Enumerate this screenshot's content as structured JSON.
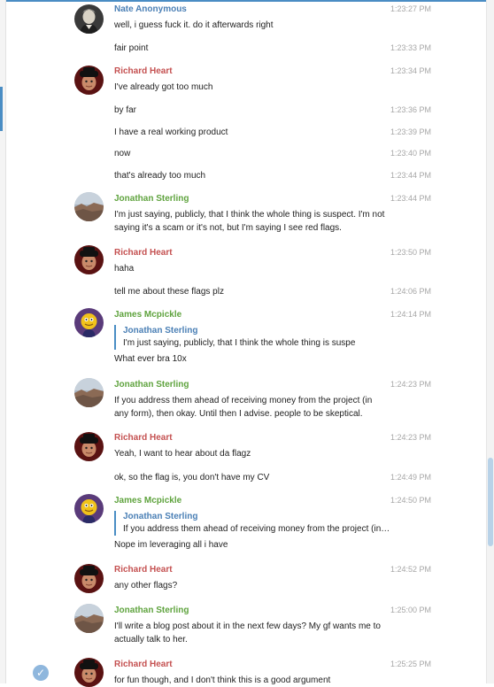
{
  "colors": {
    "accent": "#4a8dc4",
    "sender_red": "#c45050",
    "sender_green": "#5fa33e",
    "sender_blue": "#4a7fb5"
  },
  "icons": {
    "avatar_nate": "portrait-avatar-icon",
    "avatar_richard": "man-with-hat-avatar-icon",
    "avatar_jonathan": "landscape-avatar-icon",
    "avatar_james": "cartoon-avatar-icon",
    "read": "check-icon"
  },
  "messages": [
    {
      "sender": "Nate Anonymous",
      "time": "1:23:27 PM",
      "text": "well, i guess fuck it.  do it afterwards right"
    },
    {
      "time": "1:23:33 PM",
      "text": "fair point"
    },
    {
      "sender": "Richard Heart",
      "time": "1:23:34 PM",
      "text": "I've already got too much"
    },
    {
      "time": "1:23:36 PM",
      "text": "by far"
    },
    {
      "time": "1:23:39 PM",
      "text": "I have a real working product"
    },
    {
      "time": "1:23:40 PM",
      "text": "now"
    },
    {
      "time": "1:23:44 PM",
      "text": "that's already too much"
    },
    {
      "sender": "Jonathan Sterling",
      "time": "1:23:44 PM",
      "text": "I'm just saying, publicly, that I think the whole thing is suspect. I'm not saying it's a scam or it's not, but I'm saying I see red flags."
    },
    {
      "sender": "Richard Heart",
      "time": "1:23:50 PM",
      "text": "haha"
    },
    {
      "time": "1:24:06 PM",
      "text": "tell me about these flags plz"
    },
    {
      "sender": "James Mcpickle",
      "time": "1:24:14 PM",
      "reply_name": "Jonathan Sterling",
      "reply_text": "I'm just saying, publicly, that I think the whole thing is suspe",
      "text": "What ever bra 10x"
    },
    {
      "sender": "Jonathan Sterling",
      "time": "1:24:23 PM",
      "text": "If you address them ahead of receiving money from the project (in any form), then okay. Until then I advise. people to be skeptical."
    },
    {
      "sender": "Richard Heart",
      "time": "1:24:23 PM",
      "text": "Yeah, I want to hear about da flagz"
    },
    {
      "time": "1:24:49 PM",
      "text": "ok, so the flag is, you don't have my CV"
    },
    {
      "sender": "James Mcpickle",
      "time": "1:24:50 PM",
      "reply_name": "Jonathan Sterling",
      "reply_text": "If you address them ahead of receiving money from the project (in any form), then okay.",
      "text": "Nope im leveraging all i have"
    },
    {
      "sender": "Richard Heart",
      "time": "1:24:52 PM",
      "text": "any other flags?"
    },
    {
      "sender": "Jonathan Sterling",
      "time": "1:25:00 PM",
      "text": "I'll write a blog post about it in the next few days? My gf wants me to actually talk to her."
    },
    {
      "sender": "Richard Heart",
      "time": "1:25:25 PM",
      "text": "for fun though, and I don't think this is a good argument"
    }
  ]
}
